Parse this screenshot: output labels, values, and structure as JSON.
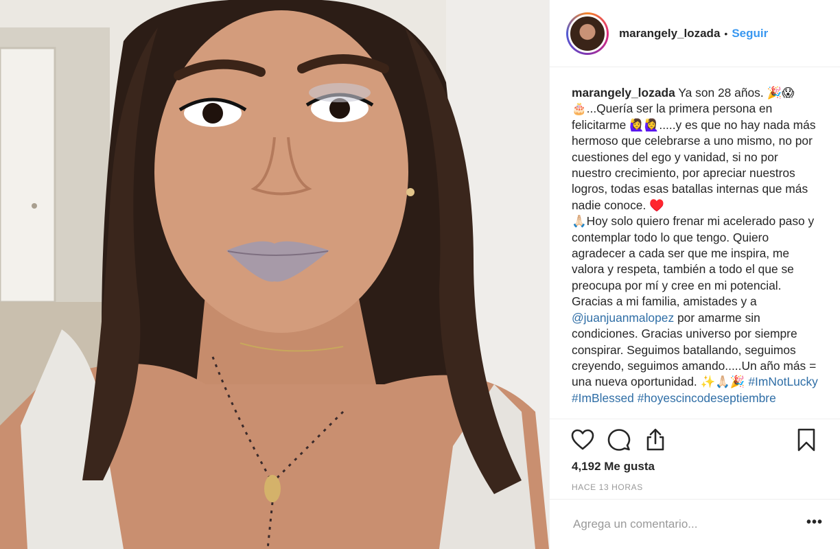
{
  "post": {
    "username": "marangely_lozada",
    "separator": "•",
    "follow_label": "Seguir",
    "caption": {
      "username": "marangely_lozada",
      "text_1": " Ya son 28 años. 🎉😱\n🎂...Quería ser la primera persona en felicitarme 🙋‍♀️🙋‍♀️.....y es que no hay nada más hermoso que celebrarse a uno mismo, no por cuestiones del ego y vanidad, si no por nuestro crecimiento, por apreciar nuestros logros, todas esas batallas internas que más nadie conoce. ♥️\n🙏🏻Hoy solo quiero frenar mi acelerado paso y contemplar todo lo que tengo. Quiero agradecer a cada ser que me inspira, me valora y respeta, también a todo el que se preocupa por mí y cree en mi potencial. Gracias a mi familia, amistades y a ",
      "mention": "@juanjuanmalopez",
      "text_2": " por amarme sin condiciones. Gracias universo por siempre conspirar. Seguimos batallando, seguimos creyendo, seguimos amando.....Un año más = una nueva oportunidad. ✨🙏🏻🎉 ",
      "hashtag_1": "#ImNotLucky",
      "hashtag_2": "#ImBlessed",
      "hashtag_3": "#hoyescincodeseptiembre"
    },
    "likes": "4,192 Me gusta",
    "timestamp": "HACE 13 HORAS",
    "comment_placeholder": "Agrega un comentario...",
    "more_label": "•••",
    "icons": [
      "heart-icon",
      "comment-icon",
      "share-icon",
      "bookmark-icon"
    ],
    "colors": {
      "link": "#3897f0",
      "text": "#262626",
      "muted": "#999999",
      "border": "#efefef"
    }
  }
}
